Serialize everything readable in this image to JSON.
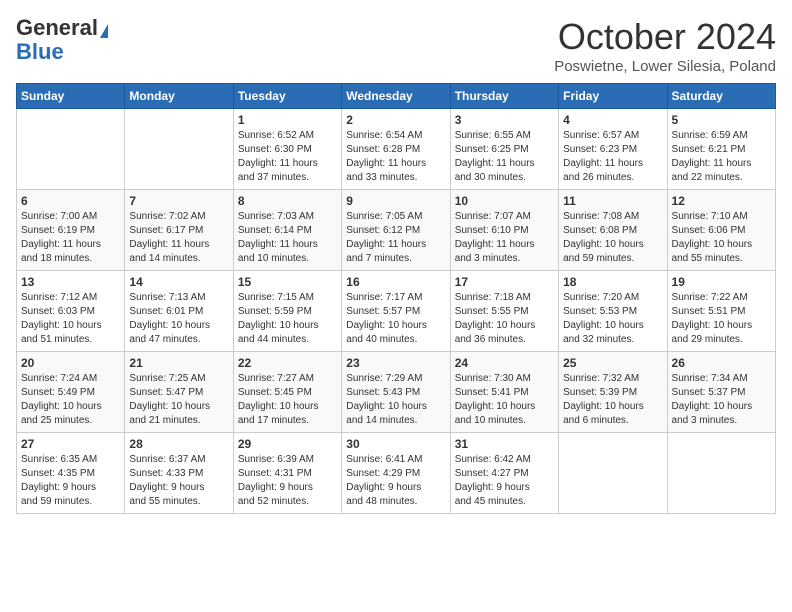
{
  "header": {
    "logo_general": "General",
    "logo_blue": "Blue",
    "month_title": "October 2024",
    "location": "Poswietne, Lower Silesia, Poland"
  },
  "weekdays": [
    "Sunday",
    "Monday",
    "Tuesday",
    "Wednesday",
    "Thursday",
    "Friday",
    "Saturday"
  ],
  "weeks": [
    [
      {
        "day": "",
        "info": ""
      },
      {
        "day": "",
        "info": ""
      },
      {
        "day": "1",
        "info": "Sunrise: 6:52 AM\nSunset: 6:30 PM\nDaylight: 11 hours\nand 37 minutes."
      },
      {
        "day": "2",
        "info": "Sunrise: 6:54 AM\nSunset: 6:28 PM\nDaylight: 11 hours\nand 33 minutes."
      },
      {
        "day": "3",
        "info": "Sunrise: 6:55 AM\nSunset: 6:25 PM\nDaylight: 11 hours\nand 30 minutes."
      },
      {
        "day": "4",
        "info": "Sunrise: 6:57 AM\nSunset: 6:23 PM\nDaylight: 11 hours\nand 26 minutes."
      },
      {
        "day": "5",
        "info": "Sunrise: 6:59 AM\nSunset: 6:21 PM\nDaylight: 11 hours\nand 22 minutes."
      }
    ],
    [
      {
        "day": "6",
        "info": "Sunrise: 7:00 AM\nSunset: 6:19 PM\nDaylight: 11 hours\nand 18 minutes."
      },
      {
        "day": "7",
        "info": "Sunrise: 7:02 AM\nSunset: 6:17 PM\nDaylight: 11 hours\nand 14 minutes."
      },
      {
        "day": "8",
        "info": "Sunrise: 7:03 AM\nSunset: 6:14 PM\nDaylight: 11 hours\nand 10 minutes."
      },
      {
        "day": "9",
        "info": "Sunrise: 7:05 AM\nSunset: 6:12 PM\nDaylight: 11 hours\nand 7 minutes."
      },
      {
        "day": "10",
        "info": "Sunrise: 7:07 AM\nSunset: 6:10 PM\nDaylight: 11 hours\nand 3 minutes."
      },
      {
        "day": "11",
        "info": "Sunrise: 7:08 AM\nSunset: 6:08 PM\nDaylight: 10 hours\nand 59 minutes."
      },
      {
        "day": "12",
        "info": "Sunrise: 7:10 AM\nSunset: 6:06 PM\nDaylight: 10 hours\nand 55 minutes."
      }
    ],
    [
      {
        "day": "13",
        "info": "Sunrise: 7:12 AM\nSunset: 6:03 PM\nDaylight: 10 hours\nand 51 minutes."
      },
      {
        "day": "14",
        "info": "Sunrise: 7:13 AM\nSunset: 6:01 PM\nDaylight: 10 hours\nand 47 minutes."
      },
      {
        "day": "15",
        "info": "Sunrise: 7:15 AM\nSunset: 5:59 PM\nDaylight: 10 hours\nand 44 minutes."
      },
      {
        "day": "16",
        "info": "Sunrise: 7:17 AM\nSunset: 5:57 PM\nDaylight: 10 hours\nand 40 minutes."
      },
      {
        "day": "17",
        "info": "Sunrise: 7:18 AM\nSunset: 5:55 PM\nDaylight: 10 hours\nand 36 minutes."
      },
      {
        "day": "18",
        "info": "Sunrise: 7:20 AM\nSunset: 5:53 PM\nDaylight: 10 hours\nand 32 minutes."
      },
      {
        "day": "19",
        "info": "Sunrise: 7:22 AM\nSunset: 5:51 PM\nDaylight: 10 hours\nand 29 minutes."
      }
    ],
    [
      {
        "day": "20",
        "info": "Sunrise: 7:24 AM\nSunset: 5:49 PM\nDaylight: 10 hours\nand 25 minutes."
      },
      {
        "day": "21",
        "info": "Sunrise: 7:25 AM\nSunset: 5:47 PM\nDaylight: 10 hours\nand 21 minutes."
      },
      {
        "day": "22",
        "info": "Sunrise: 7:27 AM\nSunset: 5:45 PM\nDaylight: 10 hours\nand 17 minutes."
      },
      {
        "day": "23",
        "info": "Sunrise: 7:29 AM\nSunset: 5:43 PM\nDaylight: 10 hours\nand 14 minutes."
      },
      {
        "day": "24",
        "info": "Sunrise: 7:30 AM\nSunset: 5:41 PM\nDaylight: 10 hours\nand 10 minutes."
      },
      {
        "day": "25",
        "info": "Sunrise: 7:32 AM\nSunset: 5:39 PM\nDaylight: 10 hours\nand 6 minutes."
      },
      {
        "day": "26",
        "info": "Sunrise: 7:34 AM\nSunset: 5:37 PM\nDaylight: 10 hours\nand 3 minutes."
      }
    ],
    [
      {
        "day": "27",
        "info": "Sunrise: 6:35 AM\nSunset: 4:35 PM\nDaylight: 9 hours\nand 59 minutes."
      },
      {
        "day": "28",
        "info": "Sunrise: 6:37 AM\nSunset: 4:33 PM\nDaylight: 9 hours\nand 55 minutes."
      },
      {
        "day": "29",
        "info": "Sunrise: 6:39 AM\nSunset: 4:31 PM\nDaylight: 9 hours\nand 52 minutes."
      },
      {
        "day": "30",
        "info": "Sunrise: 6:41 AM\nSunset: 4:29 PM\nDaylight: 9 hours\nand 48 minutes."
      },
      {
        "day": "31",
        "info": "Sunrise: 6:42 AM\nSunset: 4:27 PM\nDaylight: 9 hours\nand 45 minutes."
      },
      {
        "day": "",
        "info": ""
      },
      {
        "day": "",
        "info": ""
      }
    ]
  ]
}
